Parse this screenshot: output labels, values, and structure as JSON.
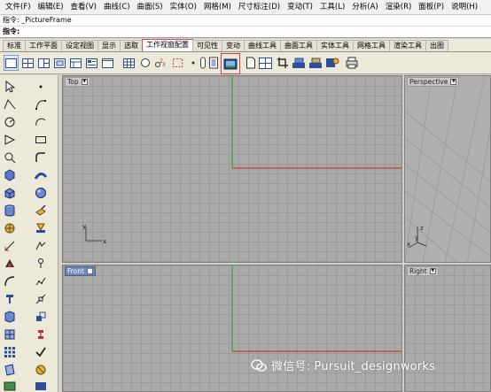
{
  "menu": [
    "文件(F)",
    "编辑(E)",
    "查看(V)",
    "曲线(C)",
    "曲面(S)",
    "实体(O)",
    "网格(M)",
    "尺寸标注(D)",
    "变动(T)",
    "工具(L)",
    "分析(A)",
    "渲染(R)",
    "面板(P)",
    "说明(H)"
  ],
  "command": {
    "history": "指令: _PictureFrame",
    "prompt": "指令:"
  },
  "tabs": [
    {
      "label": "标准",
      "active": false
    },
    {
      "label": "工作平面",
      "active": false
    },
    {
      "label": "设定视图",
      "active": false
    },
    {
      "label": "显示",
      "active": false
    },
    {
      "label": "选取",
      "active": false
    },
    {
      "label": "工作视窗配置",
      "active": true
    },
    {
      "label": "可见性",
      "active": false
    },
    {
      "label": "变动",
      "active": false
    },
    {
      "label": "曲线工具",
      "active": false
    },
    {
      "label": "曲面工具",
      "active": false
    },
    {
      "label": "实体工具",
      "active": false
    },
    {
      "label": "网格工具",
      "active": false
    },
    {
      "label": "渲染工具",
      "active": false
    },
    {
      "label": "出图",
      "active": false
    }
  ],
  "viewports": {
    "top": {
      "title": "Top"
    },
    "perspective": {
      "title": "Perspective"
    },
    "front": {
      "title": "Front"
    },
    "right": {
      "title": "Right"
    }
  },
  "axes": {
    "x": "x",
    "y": "y",
    "z": "z"
  },
  "watermark": "微信号: Pursuit_designworks",
  "colors": {
    "viewport_bg": "#aaaaaa",
    "grid": "#9a9a9a",
    "x_axis": "#c83c3c",
    "y_axis": "#3aa83a",
    "highlight": "#e03a3a"
  }
}
